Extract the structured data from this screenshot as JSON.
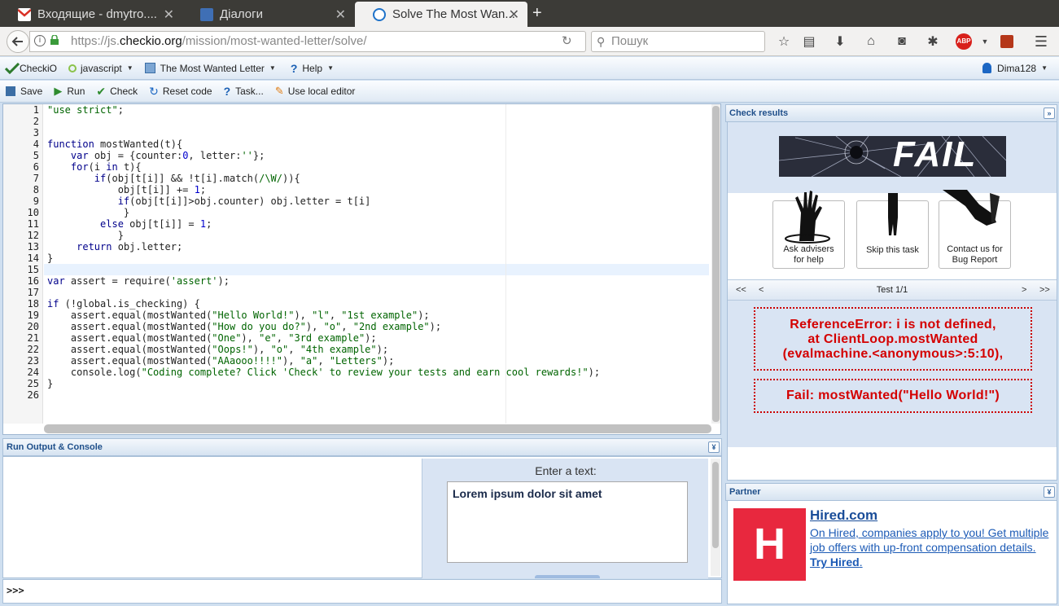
{
  "browser": {
    "tabs": [
      {
        "title": "Входящие - dmytro....",
        "favicon": "gmail-icon",
        "active": false
      },
      {
        "title": "Діалоги",
        "favicon": "chat-icon",
        "active": false
      },
      {
        "title": "Solve The Most Wan...",
        "favicon": "checkio-icon",
        "active": true
      }
    ],
    "close_glyph": "✕",
    "new_tab_glyph": "+",
    "url_prefix": "https://js.",
    "url_host": "checkio.org",
    "url_path": "/mission/most-wanted-letter/solve/",
    "search_placeholder": "Пошук",
    "abp_label": "ABP"
  },
  "toolbar": {
    "brand": "CheckiO",
    "language": "javascript",
    "mission": "The Most Wanted Letter",
    "help": "Help",
    "user": "Dima128",
    "save": "Save",
    "run": "Run",
    "check": "Check",
    "reset": "Reset code",
    "task": "Task...",
    "local_editor": "Use local editor"
  },
  "editor": {
    "line_numbers": [
      "1",
      "2",
      "3",
      "4",
      "5",
      "6",
      "7",
      "8",
      "9",
      "10",
      "11",
      "12",
      "13",
      "14",
      "15",
      "16",
      "17",
      "18",
      "19",
      "20",
      "21",
      "22",
      "23",
      "24",
      "25",
      "26"
    ],
    "lines": [
      "\"use strict\";",
      "",
      "",
      "function mostWanted(t){",
      "    var obj = {counter:0, letter:''};",
      "    for(i in t){",
      "        if(obj[t[i]] && !t[i].match(/\\W/)){",
      "            obj[t[i]] += 1;",
      "            if(obj[t[i]]>obj.counter) obj.letter = t[i]",
      "             }",
      "         else obj[t[i]] = 1;",
      "            }",
      "     return obj.letter;",
      "}",
      "",
      "var assert = require('assert');",
      "",
      "if (!global.is_checking) {",
      "    assert.equal(mostWanted(\"Hello World!\"), \"l\", \"1st example\");",
      "    assert.equal(mostWanted(\"How do you do?\"), \"o\", \"2nd example\");",
      "    assert.equal(mostWanted(\"One\"), \"e\", \"3rd example\");",
      "    assert.equal(mostWanted(\"Oops!\"), \"o\", \"4th example\");",
      "    assert.equal(mostWanted(\"AAaooo!!!!\"), \"a\", \"Letters\");",
      "    console.log(\"Coding complete? Click 'Check' to review your tests and earn cool rewards!\");",
      "}",
      ""
    ],
    "current_line": 15
  },
  "results": {
    "title": "Check results",
    "fail_banner": "FAIL",
    "ask_advisers": "Ask advisers for help",
    "skip_task": "Skip this task",
    "contact_us": "Contact us for Bug Report",
    "nav_first": "<<",
    "nav_prev": "<",
    "nav_next": ">",
    "nav_last": ">>",
    "test_label": "Test 1/1",
    "error_line1": "ReferenceError: i is not defined,",
    "error_line2": "at ClientLoop.mostWanted",
    "error_line3": "(evalmachine.<anonymous>:5:10),",
    "fail_message": "Fail: mostWanted(\"Hello World!\")"
  },
  "partner": {
    "title": "Partner",
    "logo_letter": "H",
    "name": "Hired.com",
    "description": "On Hired, companies apply to you! Get multiple job offers with up-front compensation details.",
    "cta": "Try Hired",
    "cta_suffix": "."
  },
  "console": {
    "title": "Run Output & Console",
    "enter_label": "Enter a text:",
    "input_value": "Lorem ipsum dolor sit amet",
    "prompt": ">>>"
  },
  "colors": {
    "accent": "#1f4f8a",
    "error": "#d40000",
    "hired": "#e8283e"
  }
}
